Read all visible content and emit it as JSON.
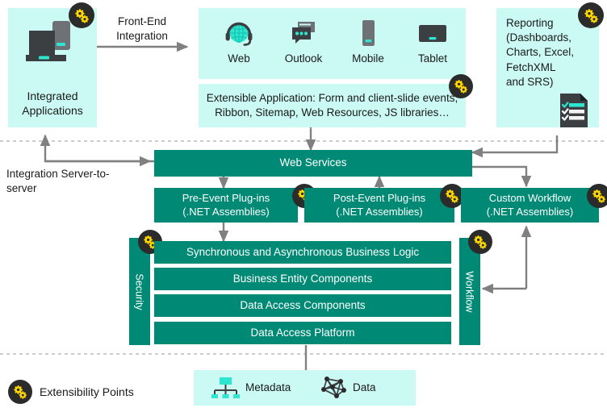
{
  "diagram": {
    "title_note": "Dynamics 365 / CRM extensibility architecture",
    "colors": {
      "teal": "#008a76",
      "cyan_panel": "#cbf9f3",
      "cyan_accent": "#2ee6d0",
      "badge_dark": "#2b2b2b",
      "gear_yellow": "#ffd800",
      "connector_gray": "#808080",
      "text_dark": "#1a1a1a"
    },
    "integrated_applications": {
      "label": "Integrated\nApplications",
      "label_line1": "Integrated",
      "label_line2": "Applications",
      "icon": "laptop-phone-icon",
      "badge": "extensibility-gear-badge"
    },
    "front_end_integration": {
      "label_line1": "Front-End",
      "label_line2": "Integration",
      "arrow": "double-headed-horizontal-arrow"
    },
    "clients": {
      "items": [
        {
          "label": "Web",
          "icon": "globe-headset-icon"
        },
        {
          "label": "Outlook",
          "icon": "chat-bubbles-icon"
        },
        {
          "label": "Mobile",
          "icon": "phone-icon"
        },
        {
          "label": "Tablet",
          "icon": "tablet-icon"
        }
      ]
    },
    "extensible_application": {
      "line1": "Extensible Application: Form and client-slide events,",
      "line2": "Ribbon, Sitemap, Web Resources, JS libraries…",
      "badge": "extensibility-gear-badge"
    },
    "reporting": {
      "lines": [
        "Reporting",
        "(Dashboards,",
        "Charts, Excel,",
        "FetchXML",
        "and SRS)"
      ],
      "icon": "report-checklist-icon",
      "badge": "extensibility-gear-badge"
    },
    "integration_server": {
      "line1": "Integration Server-to-",
      "line2": "server"
    },
    "web_services": {
      "label": "Web Services"
    },
    "plugins": [
      {
        "line1": "Pre-Event Plug-ins",
        "line2": "(.NET Assemblies)",
        "badge": "extensibility-gear-badge"
      },
      {
        "line1": "Post-Event Plug-ins",
        "line2": "(.NET Assemblies)",
        "badge": "extensibility-gear-badge"
      },
      {
        "line1": "Custom Workflow",
        "line2": "(.NET Assemblies)",
        "badge": "extensibility-gear-badge"
      }
    ],
    "security_bar": {
      "label": "Security",
      "badge": "extensibility-gear-badge"
    },
    "workflow_bar": {
      "label": "Workflow",
      "badge": "extensibility-gear-badge"
    },
    "core_layers": [
      {
        "label": "Synchronous and Asynchronous Business Logic"
      },
      {
        "label": "Business Entity Components"
      },
      {
        "label": "Data Access Components"
      },
      {
        "label": "Data Access Platform"
      }
    ],
    "storage": {
      "items": [
        {
          "label": "Metadata",
          "icon": "hierarchy-icon"
        },
        {
          "label": "Data",
          "icon": "node-graph-icon"
        }
      ]
    },
    "legend": {
      "label": "Extensibility Points",
      "badge": "extensibility-gear-badge"
    }
  }
}
